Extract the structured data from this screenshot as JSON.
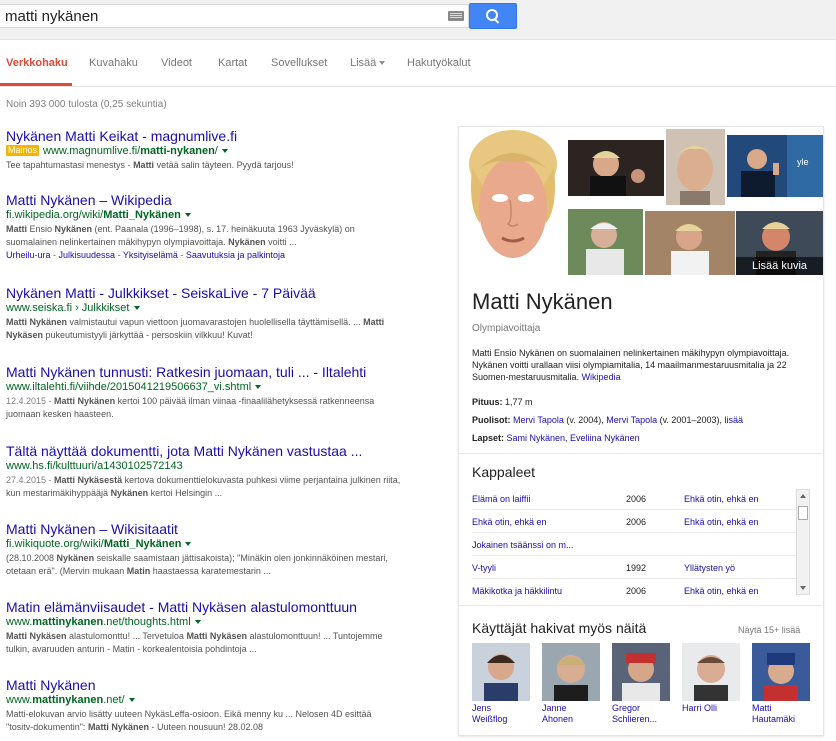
{
  "search": {
    "query": "matti nykänen"
  },
  "tabs": [
    {
      "label": "Verkkohaku",
      "active": true
    },
    {
      "label": "Kuvahaku"
    },
    {
      "label": "Videot"
    },
    {
      "label": "Kartat"
    },
    {
      "label": "Sovellukset"
    },
    {
      "label": "Lisää"
    },
    {
      "label": "Hakutyökalut"
    }
  ],
  "stats": "Noin 393 000 tulosta (0,25 sekuntia)",
  "results": [
    {
      "title": "Nykänen Matti Keikat - magnumlive.fi",
      "ad": "Mainos",
      "url_pre": "www.magnumlive.fi/",
      "url_bold": "matti-nykanen",
      "url_post": "/",
      "snippet_html": "Tee tapahtumastasi menestys - <b>Matti</b> vetää salin täyteen. Pyydä tarjous!"
    },
    {
      "title": "Matti Nykänen – Wikipedia",
      "url_pre": "fi.wikipedia.org/wiki/",
      "url_bold": "Matti_Nykänen",
      "url_post": "",
      "snippet_html": "<b>Matti</b> Ensio <b>Nykänen</b> (ent. Paanala (1996–1998), s. 17. heinäkuuta 1963 Jyväskylä) on suomalainen nelinkertainen mäkihypyn olympiavoittaja. <b>Nykänen</b> voitti ...",
      "sitelinks": [
        "Urheilu-ura",
        "Julkisuudessa",
        "Yksityiselämä",
        "Saavutuksia ja palkintoja"
      ]
    },
    {
      "title": "Nykänen Matti - Julkkikset - SeiskaLive - 7 Päivää",
      "url_pre": "www.seiska.fi",
      "url_bold": "",
      "url_post": " › Julkkikset",
      "snippet_html": "<b>Matti Nykänen</b> valmistautui vapun viettoon juomavarastojen huolellisella täyttämisellä. ... <b>Matti Nykäsen</b> pukeutumistyyli järkyttää - persoskiin vilkkuu! Kuvat!"
    },
    {
      "title": "Matti Nykänen tunnusti: Ratkesin juomaan, tuli ... - Iltalehti",
      "url_pre": "www.iltalehti.fi/viihde/2015041219506637_vi.shtml",
      "url_bold": "",
      "url_post": "",
      "date": "12.4.2015 - ",
      "snippet_html": "<b>Matti Nykänen</b> kertoi 100 päivää ilman viinaa -finaalilähetyksessä ratkenneensa juomaan kesken haasteen."
    },
    {
      "title": "Tältä näyttää dokumentti, jota Matti Nykänen vastustaa ...",
      "url_pre": "www.hs.fi/kulttuuri/a1430102572143",
      "url_bold": "",
      "url_post": "",
      "date": "27.4.2015 - ",
      "snippet_html": "<b>Matti Nykäsestä</b> kertova dokumenttielokuvasta puhkesi viime perjantaina julkinen riita, kun mestarimäkihyppääjä <b>Nykänen</b> kertoi Helsingin ..."
    },
    {
      "title": "Matti Nykänen – Wikisitaatit",
      "url_pre": "fi.wikiquote.org/wiki/",
      "url_bold": "Matti_Nykänen",
      "url_post": "",
      "snippet_html": "(28.10.2008 <b>Nykänen</b> seiskalle saamistaan jättisakoista); \"Minäkin olen jonkinnäköinen mestari, otetaan erä\". (Mervin mukaan <b>Matin</b> haastaessa karatemestarin ..."
    },
    {
      "title": "Matin elämänviisaudet - Matti Nykäsen alastulomonttuun",
      "url_pre": "www.",
      "url_bold": "mattinykanen",
      "url_post": ".net/thoughts.html",
      "snippet_html": "<b>Matti Nykäsen</b> alastulomonttu! ... Tervetuloa <b>Matti Nykäsen</b> alastulomonttuun! ... Tuntojemme tulkin, avaruuden anturin - Matin - korkealentoisia pohdintoja ..."
    },
    {
      "title": "Matti Nykänen",
      "url_pre": "www.",
      "url_bold": "mattinykanen",
      "url_post": ".net/",
      "snippet_html": "Matti-elokuvan arvio lisätty uuteen NykäsLeffa-osioon. Eikä menny ku ... Nelosen 4D esittää \"tositv-dokumentin\": <b>Matti Nykänen</b> - Uuteen nousuun! 28.02.08"
    }
  ],
  "kp": {
    "more_images": "Lisää kuvia",
    "name": "Matti Nykänen",
    "subtitle": "Olympiavoittaja",
    "description": "Matti Ensio Nykänen on suomalainen nelinkertainen mäkihypyn olympiavoittaja. Nykänen voitti urallaan viisi olympiamitalia, 14 maailmanmestaruusmitalia ja 22 Suomen-mestaruusmitalia.",
    "desc_source": "Wikipedia",
    "height_label": "Pituus:",
    "height_value": "1,77 m",
    "spouses_label": "Puolisot:",
    "spouse1": "Mervi Tapola",
    "spouse1_years": " (v. 2004), ",
    "spouse2": "Mervi Tapola",
    "spouse2_years": " (v. 2001–2003), ",
    "spouses_more": "lisää",
    "children_label": "Lapset:",
    "children": "Sami Nykänen, Eveliina Nykänen",
    "songs_heading": "Kappaleet",
    "songs": [
      {
        "title": "Elämä on laiffii",
        "year": "2006",
        "album": "Ehkä otin, ehkä en"
      },
      {
        "title": "Ehkä otin, ehkä en",
        "year": "2006",
        "album": "Ehkä otin, ehkä en"
      },
      {
        "title": "Jokainen tsäänssi on m...",
        "year": "",
        "album": ""
      },
      {
        "title": "V-tyyli",
        "year": "1992",
        "album": "Yllätysten yö"
      },
      {
        "title": "Mäkikotka ja häkkilintu",
        "year": "2006",
        "album": "Ehkä otin, ehkä en"
      }
    ],
    "also_heading": "Käyttäjät hakivat myös näitä",
    "also_more": "Näytä 15+ lisää",
    "also": [
      {
        "line1": "Jens",
        "line2": "Weißflog"
      },
      {
        "line1": "Janne",
        "line2": "Ahonen"
      },
      {
        "line1": "Gregor",
        "line2": "Schlieren..."
      },
      {
        "line1": "Harri Olli",
        "line2": ""
      },
      {
        "line1": "Matti",
        "line2": "Hautamäki"
      }
    ]
  }
}
